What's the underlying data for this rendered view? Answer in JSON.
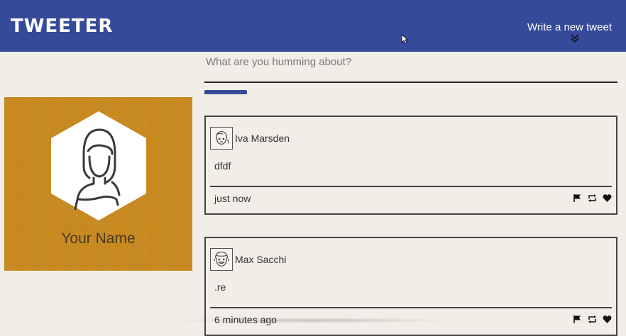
{
  "nav": {
    "brand": "TWEETER",
    "write_label": "Write a new tweet",
    "write_icon": "double-chevron-down-icon"
  },
  "profile": {
    "name": "Your Name",
    "background_color": "#c98a1f"
  },
  "composer": {
    "placeholder": "What are you humming about?",
    "value": ""
  },
  "tweets": [
    {
      "author": "Iva Marsden",
      "content": "dfdf",
      "time": "just now",
      "actions": [
        "flag-icon",
        "retweet-icon",
        "heart-icon"
      ]
    },
    {
      "author": "Max Sacchi",
      "content": ".re",
      "time": "6 minutes ago",
      "actions": [
        "flag-icon",
        "retweet-icon",
        "heart-icon"
      ]
    }
  ],
  "colors": {
    "nav": "#364a9a",
    "page": "#f1eee8",
    "profile": "#c98a1f"
  }
}
